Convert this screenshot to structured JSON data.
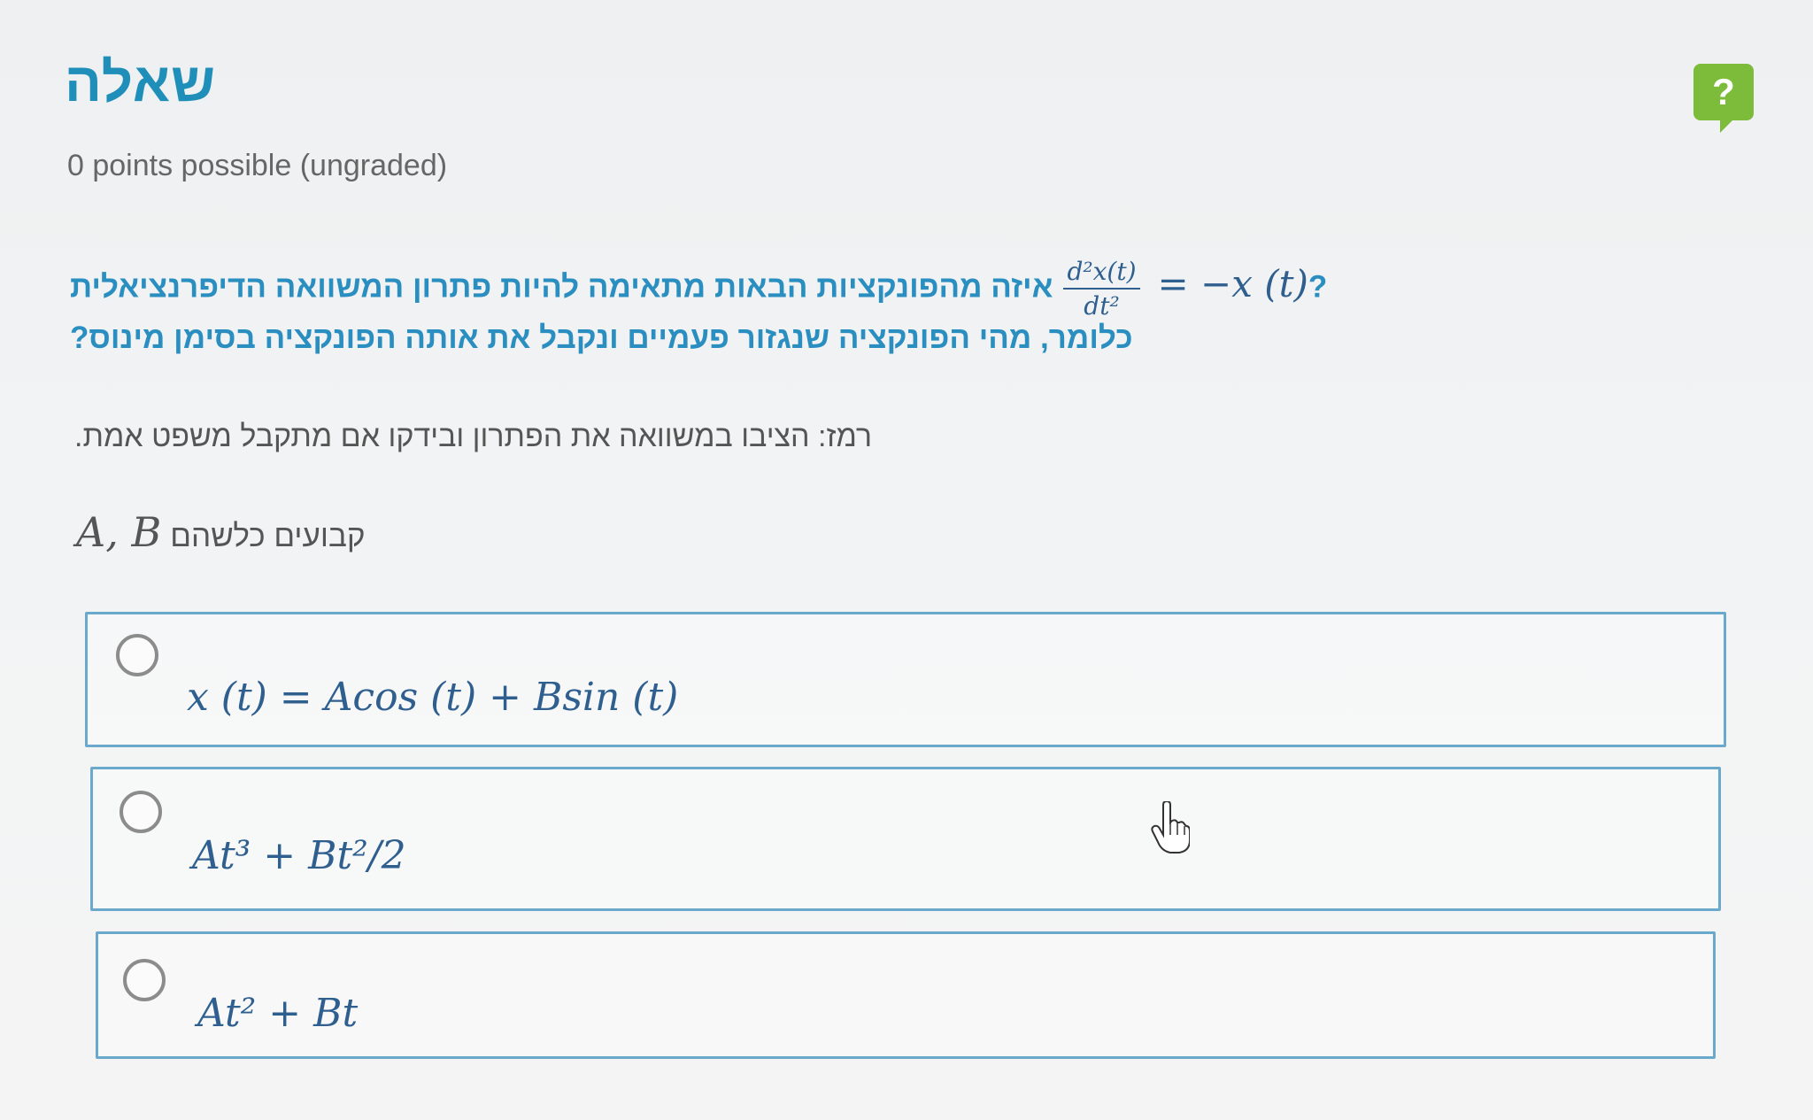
{
  "header": {
    "title": "שאלה",
    "help_label": "?"
  },
  "points": "0 points possible (ungraded)",
  "question": {
    "line1_text": "איזה מהפונקציות הבאות מתאימה להיות פתרון המשוואה הדיפרנציאלית",
    "equation_numerator": "d²x(t)",
    "equation_denominator": "dt²",
    "equation_rhs": "= −x (t)",
    "line1_end": "?",
    "line2_text": "כלומר, מהי הפונקציה שנגזור פעמיים ונקבל את אותה הפונקציה בסימן מינוס?"
  },
  "hint": "רמז: הציבו במשוואה את הפתרון ובידקו אם מתקבל משפט אמת.",
  "constants": {
    "text": "קבועים כלשהם",
    "symbols": "A, B"
  },
  "options": [
    {
      "label": "x (t) = Acos (t) + Bsin (t)"
    },
    {
      "label": "At³ + Bt²/2"
    },
    {
      "label": "At² + Bt"
    }
  ],
  "icons": {
    "help": "help-question-icon",
    "cursor": "hand-pointer-icon"
  },
  "colors": {
    "title": "#1f8fba",
    "question": "#2a8fc0",
    "help_button": "#7dbb3a",
    "option_border": "#6aa9cc"
  }
}
